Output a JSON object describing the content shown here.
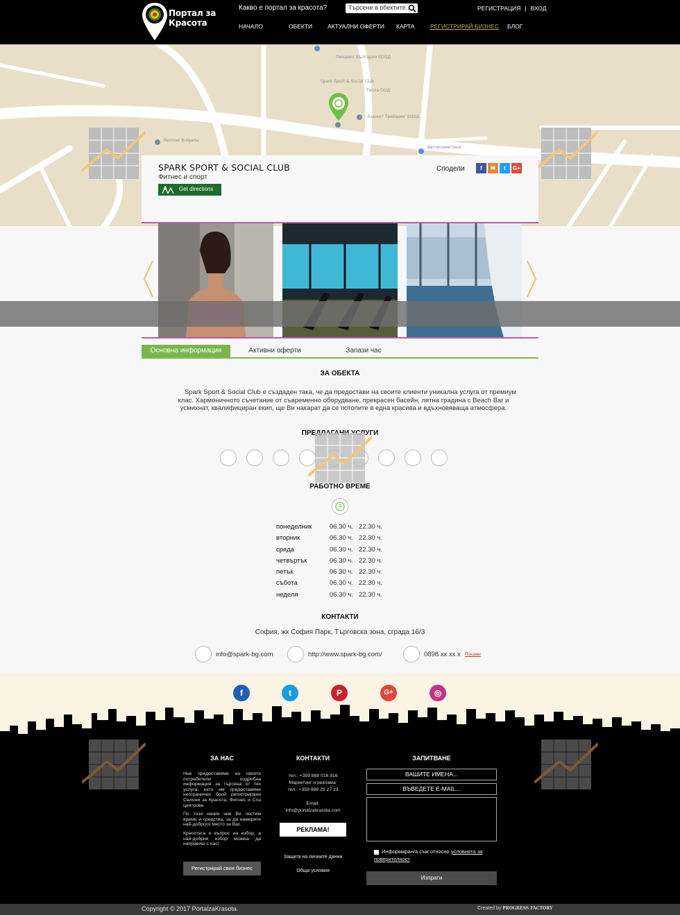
{
  "header": {
    "logo_line1": "Портал за",
    "logo_line2": "Красота",
    "question": "Какво е портал за красота?",
    "search_placeholder": "Търсене в обектите...",
    "register": "РЕГИСТРАЦИЯ",
    "separator": "|",
    "login": "ВХОД",
    "nav": [
      "НАЧАЛО",
      "ОБЕКТИ",
      "АКТУАЛНИ ОФЕРТИ",
      "КАРТА",
      "РЕГИСТРИРАЙ БИЗНЕС",
      "БЛОГ"
    ]
  },
  "map": {
    "labels": [
      "Пиндекс България ЕООД",
      "Spark Sport & Social Club",
      "Тесла ООД",
      "Канонт Трейдинг ЕООД",
      "Renmer Bulgaria",
      "Автокозметики"
    ]
  },
  "card": {
    "title": "SPARK SPORT & SOCIAL CLUB",
    "category": "Фитнес и спорт",
    "directions": "Get directions",
    "share_label": "Сподели",
    "share_icons": [
      {
        "icon": "facebook-icon",
        "glyph": "f",
        "color": "#3b5998"
      },
      {
        "icon": "mail-icon",
        "glyph": "✉",
        "color": "#e5863a"
      },
      {
        "icon": "twitter-icon",
        "glyph": "t",
        "color": "#1da1f2"
      },
      {
        "icon": "google-plus-icon",
        "glyph": "G+",
        "color": "#dd4b39"
      }
    ]
  },
  "tabs": [
    "Основна информация",
    "Активни оферти",
    "Запази час"
  ],
  "about": {
    "heading": "ЗА ОБЕКТА",
    "text": "Spark Sport & Social Club е създаден така, че да предостави на своите клиенти уникална услуга от премиум клас. Хармоничното съчетание от съвременно оборудване, прекрасен басейн, лятна градина с Beach Bar и усмихнат, квалифициран екип, ще Ви накарат да се потопите в една красива и вдъхновяваща атмосфера."
  },
  "services": {
    "heading": "ПРЕДЛАГАНИ УСЛУГИ",
    "icons": [
      "fitness-icon",
      "boxing-icon",
      "yoga-icon",
      "nordic-walking-icon",
      "running-icon",
      "martial-arts-icon",
      "swimming-icon",
      "dance-icon",
      "spa-icon"
    ]
  },
  "hours": {
    "heading": "РАБОТНО ВРЕМЕ",
    "rows": [
      {
        "day": "понеделник",
        "open": "06.30 ч.",
        "close": "22.30 ч."
      },
      {
        "day": "вторник",
        "open": "06.30 ч.",
        "close": "22.30 ч."
      },
      {
        "day": "сряда",
        "open": "06.30 ч.",
        "close": "22.30 ч."
      },
      {
        "day": "четвъртък",
        "open": "06.30 ч.",
        "close": "22.30 ч."
      },
      {
        "day": "петък",
        "open": "06.30 ч.",
        "close": "22.30 ч."
      },
      {
        "day": "събота",
        "open": "06.30 ч.",
        "close": "22.30 ч."
      },
      {
        "day": "неделя",
        "open": "06.30 ч.",
        "close": "22.30 ч."
      }
    ]
  },
  "contacts": {
    "heading": "КОНТАКТИ",
    "address": "София, жк София Парк, Търговска зона, сграда 16/3",
    "email": "info@spark-bg.com",
    "website": "http://www.spark-bg.com/",
    "phone": "0898 xx xx x",
    "show": "Покажи"
  },
  "social": [
    {
      "icon": "facebook-icon",
      "glyph": "f",
      "color": "#1f5fb5"
    },
    {
      "icon": "twitter-icon",
      "glyph": "t",
      "color": "#1d9be0"
    },
    {
      "icon": "pinterest-icon",
      "glyph": "P",
      "color": "#c8232c"
    },
    {
      "icon": "google-plus-icon",
      "glyph": "G+",
      "color": "#e0463a"
    },
    {
      "icon": "instagram-icon",
      "glyph": "◎",
      "color": "#c13584"
    }
  ],
  "footer": {
    "about_heading": "ЗА НАС",
    "about_p1": "Ние предоставяме на своите потребители подробна информация за търсена от тях услуга, като им предоставяме неограничен брой регистрирани Салони за Красота, Фитнес и Спа центрове.",
    "about_p2": "По този начин ние Ви пестим време и средства, за да намерите най-доброто място за Вас.",
    "about_p3": "Красотата е въпрос на избор, а най-добрия избор можеш да направиш с нас!",
    "register_btn": "Регистрирай своя бизнес",
    "contacts_heading": "КОНТАКТИ",
    "phone": "тел.: +359 888 016 816",
    "marketing": "Маркетинг и реклама:",
    "phone2": "тел.: +359 888 25 27 23",
    "email_label": "Email:",
    "email": "info@portalzakrasota.com",
    "ad_btn": "РЕКЛАМА!",
    "privacy": "Защита на личните данни",
    "terms": "Общи условия",
    "inquiry_heading": "ЗАПИТВАНЕ",
    "name_ph": "ВАШИТЕ ИМЕНА...",
    "email_ph": "ВЪВЕДЕТЕ E-MAIL...",
    "consent_pre": "Информиран/а съм относно",
    "consent_link": "условията за поверителност",
    "send": "Изпрати"
  },
  "copyright": {
    "text": "Copyright © 2017 PortalzaKrasota.",
    "created": "Created by",
    "agency": "PROGRESS FACTORY"
  }
}
